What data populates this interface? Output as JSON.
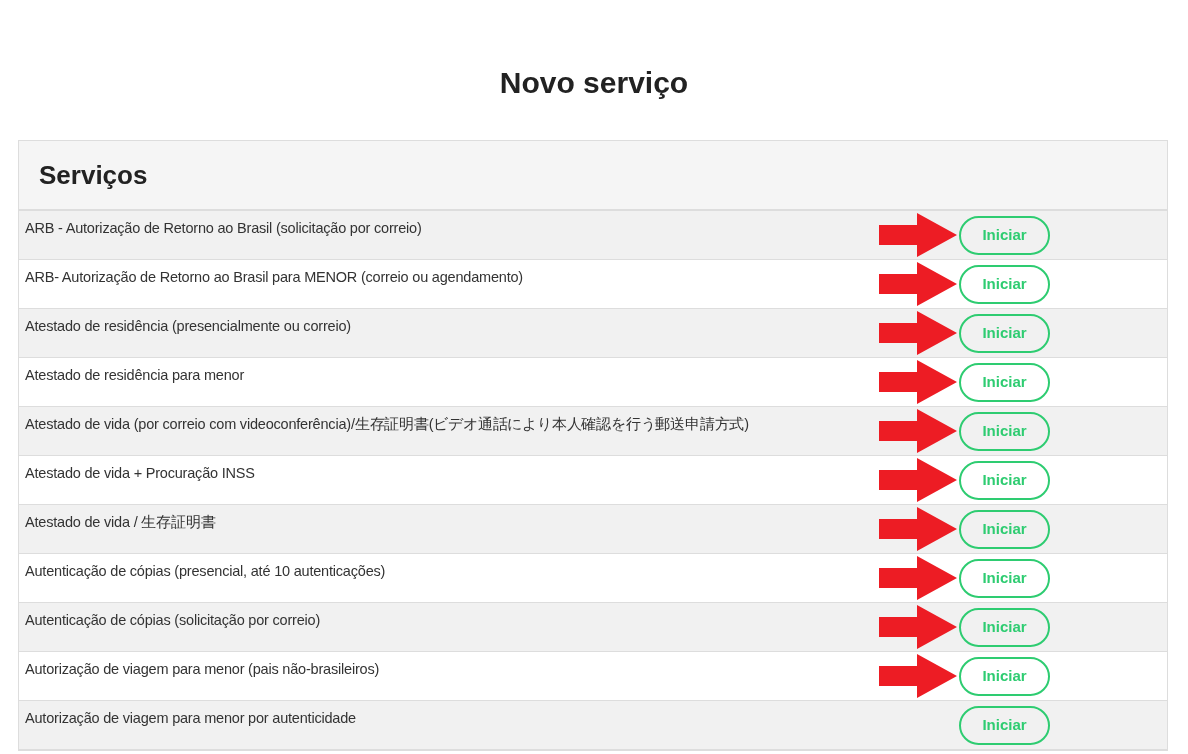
{
  "title": "Novo serviço",
  "panel": {
    "heading": "Serviços",
    "services": [
      {
        "name": "ARB - Autorização de Retorno ao Brasil (solicitação por correio)",
        "button": "Iniciar",
        "arrow": true
      },
      {
        "name": "ARB- Autorização de Retorno ao Brasil para MENOR (correio ou agendamento)",
        "button": "Iniciar",
        "arrow": true
      },
      {
        "name": "Atestado de residência (presencialmente ou correio)",
        "button": "Iniciar",
        "arrow": true
      },
      {
        "name": "Atestado de residência para menor",
        "button": "Iniciar",
        "arrow": true
      },
      {
        "name": "Atestado de vida (por correio com videoconferência)/生存証明書(ビデオ通話により本人確認を行う郵送申請方式)",
        "button": "Iniciar",
        "arrow": true
      },
      {
        "name": "Atestado de vida + Procuração INSS",
        "button": "Iniciar",
        "arrow": true
      },
      {
        "name": "Atestado de vida / 生存証明書",
        "button": "Iniciar",
        "arrow": true
      },
      {
        "name": "Autenticação de cópias (presencial, até 10 autenticações)",
        "button": "Iniciar",
        "arrow": true
      },
      {
        "name": "Autenticação de cópias (solicitação por correio)",
        "button": "Iniciar",
        "arrow": true
      },
      {
        "name": "Autorização de viagem para menor (pais não-brasileiros)",
        "button": "Iniciar",
        "arrow": true
      },
      {
        "name": "Autorização de viagem para menor por autenticidade",
        "button": "Iniciar",
        "arrow": false
      }
    ]
  }
}
